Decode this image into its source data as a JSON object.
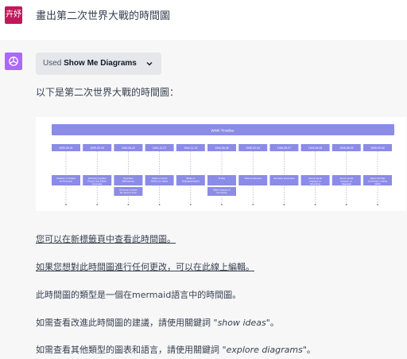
{
  "user": {
    "avatar_text": "卉妤",
    "message": "畫出第二次世界大戰的時間圖"
  },
  "assistant": {
    "plugin_used_prefix": "Used",
    "plugin_name": "Show Me Diagrams",
    "intro": "以下是第二次世界大戰的時間圖：",
    "diagram": {
      "title": "WWII Timeline",
      "dates": [
        "1939-09-01",
        "1939-09-03",
        "1940-06-22",
        "1941-12-07",
        "1942-11-19",
        "1944-06-06",
        "1945-02-04",
        "1945-05-07",
        "1945-08-06",
        "1945-08-09",
        "1945-09-02"
      ],
      "events": [
        "Invasion of Poland by Germany",
        "Germany Invades France and Britain Concedes",
        "Operation Barbarossa",
        "Attack on Pearl Harbor by Japan",
        "Battle of Stalingrad begins",
        "D-Day",
        "Yalta Conference",
        "Germany surrenders",
        "Atomic bomb dropped on Hiroshima",
        "Atomic bomb dropped on Nagasaki",
        "Japan formally surrenders, ending WWII"
      ],
      "extra_events": {
        "2": "Germany Invades the Soviet Union",
        "5": "Allied Invasion of Normandy"
      }
    },
    "lines": {
      "open_new_tab": "您可以在新標籤頁中查看此時間圖。",
      "edit_online": "如果您想對此時間圖進行任何更改，可以在此線上編輯。",
      "type_info": "此時間圖的類型是一個在mermaid語言中的時間圖。",
      "ideas_prefix": "如需查看改進此時間圖的建議，請使用關鍵詞 \"",
      "ideas_keyword": "show ideas",
      "ideas_suffix": "\"。",
      "explore_prefix": "如需查看其他類型的圖表和語言，請使用關鍵詞 \"",
      "explore_keyword": "explore diagrams",
      "explore_suffix": "\"。"
    }
  },
  "colors": {
    "accent": "#8b8be8",
    "user_avatar": "#c2185b",
    "assistant_avatar": "#ab68ff"
  }
}
